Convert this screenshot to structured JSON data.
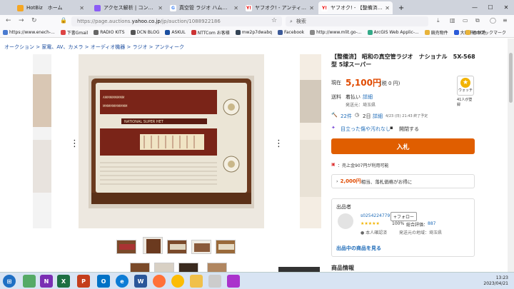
{
  "browser": {
    "tabs": [
      {
        "label": "HotBiz　ホーム",
        "active": false
      },
      {
        "label": "アクセス解析 | コントロールパ",
        "active": false
      },
      {
        "label": "真空管 ラジオ ハム音：わすれ",
        "active": false
      },
      {
        "label": "ヤフオク! - アンティーク(ラジ",
        "active": false
      },
      {
        "label": "ヤフオク! - 【整備済】 昭和の",
        "active": true
      }
    ],
    "new_tab": "+",
    "url_prefix": "https://page.auctions.",
    "url_domain": "yahoo.co.jp",
    "url_suffix": "/jp/auction/1088922186",
    "search_placeholder": "検索"
  },
  "bookmarks": [
    "https://www.enech-...",
    "下書Gmail",
    "RADIO KITS",
    "DCN BLOG",
    "ASKUL",
    "NTTCom お客様",
    "mw2p7dwabq",
    "Facebook",
    "http://www.mlit.go-...",
    "ArcGIS Web Applic-...",
    "競売物件",
    "大町市の林地",
    "他のブックマーク"
  ],
  "breadcrumb": "オークション > 家電、AV、カメラ > オーディオ機器 > ラジオ > アンティーク",
  "product": {
    "title": "【整備済】 昭和の真空管ラジオ　ナショナル　5X-568型 5球スーパー",
    "current_label": "現在",
    "price": "5,100円",
    "tax": "(税 0 円)",
    "watch_label": "ウォッチ",
    "watch_count": "41人が登録",
    "shipping_label": "送料",
    "shipping_value": "着払い",
    "shipping_detail": "詳細",
    "origin": "発送元：埼玉県",
    "bids": "22件",
    "remaining": "2日",
    "remaining_detail": "詳細",
    "end_time": "4/23 (日) 21:43 終了予定",
    "condition_link": "目立った傷や汚れなし",
    "discount_link": "開閉する",
    "bid_button": "入札",
    "points": "：売上金907円が利用可能",
    "coupon_amount": "2,000円",
    "coupon_text": "相当、落札価格がお得に"
  },
  "seller": {
    "heading": "出品者",
    "id": "s0254224779",
    "follow": "+フォロー",
    "rating_percent": "100%",
    "rating_label": "総合評価：",
    "rating_value": "887",
    "verified": "本人確認済",
    "region": "発送元の地域：埼玉県",
    "items_link": "出品中の商品を見る"
  },
  "section_heading": "商品情報",
  "taskbar": {
    "time": "13:23",
    "date": "2023/04/21"
  },
  "colors": {
    "accent": "#e05e00",
    "price": "#e04a00",
    "link": "#1e6bb8",
    "tabbar": "#cfd3dc"
  }
}
